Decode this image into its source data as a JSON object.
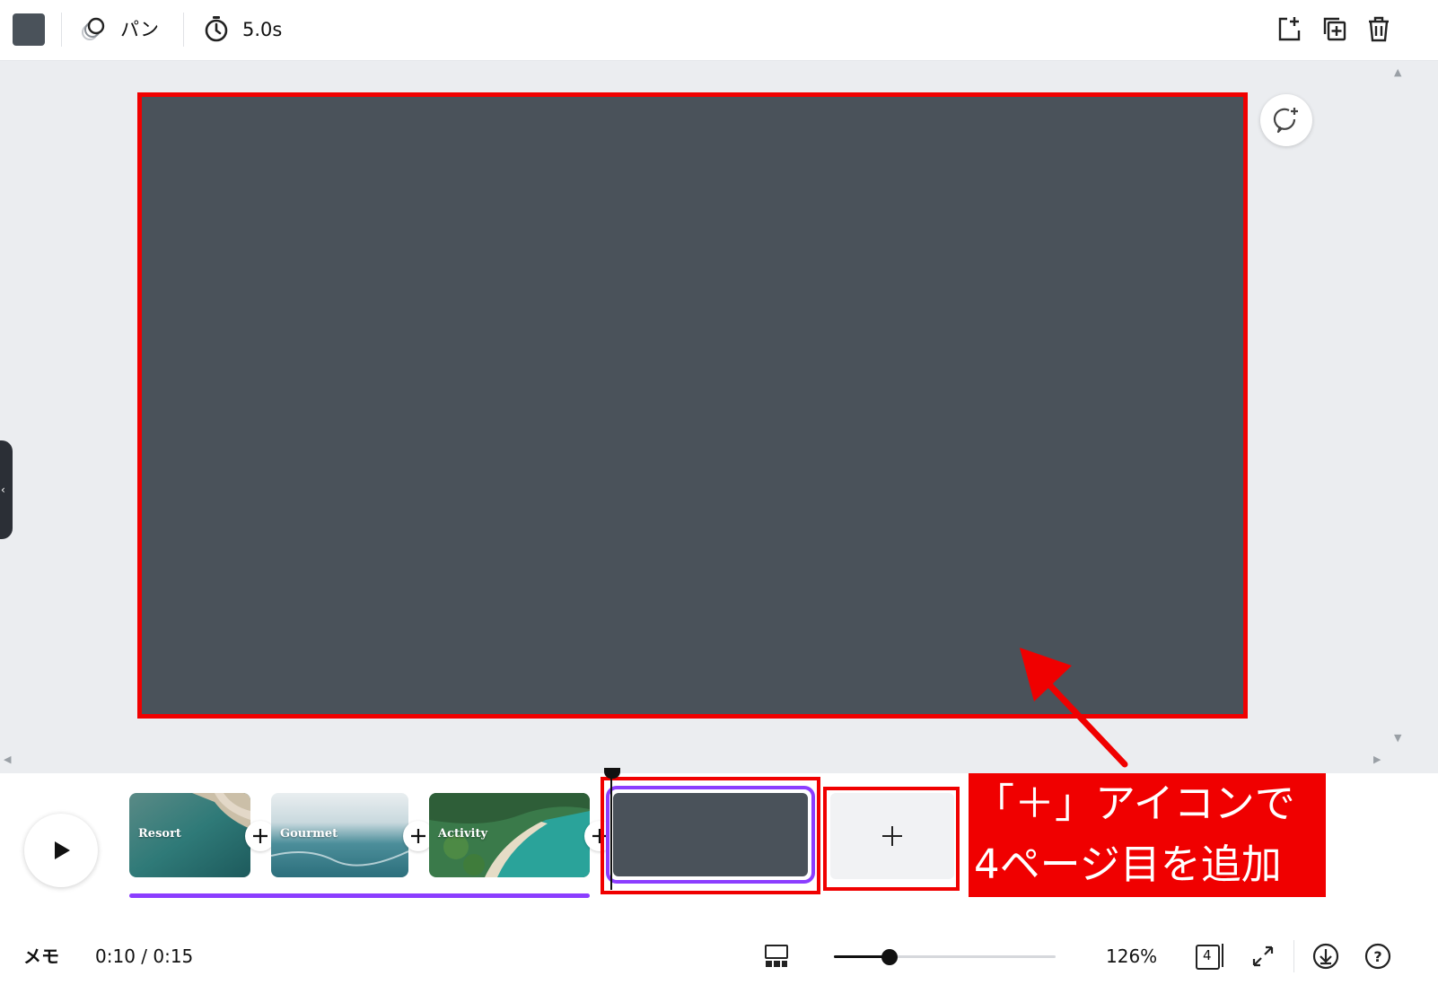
{
  "toolbar": {
    "color_swatch": "#4a525a",
    "animation_label": "パン",
    "duration_label": "5.0s",
    "icons": [
      "animate-icon",
      "timer-icon",
      "add-page-icon",
      "duplicate-page-icon",
      "trash-icon"
    ]
  },
  "canvas": {
    "page_color": "#4a525a",
    "highlight_color": "#f00000"
  },
  "timeline": {
    "pages": [
      {
        "label": "Resort"
      },
      {
        "label": "Gourmet"
      },
      {
        "label": "Activity"
      },
      {
        "label": ""
      }
    ],
    "progress_color": "#8b3dff",
    "selected_page": 4
  },
  "annotation": {
    "line1": "「＋」アイコンで",
    "line2": "4ページ目を追加"
  },
  "bottombar": {
    "notes_label": "メモ",
    "time": "0:10 / 0:15",
    "zoom_level": "126%",
    "zoom_fraction": 0.25,
    "page_count": "4"
  }
}
